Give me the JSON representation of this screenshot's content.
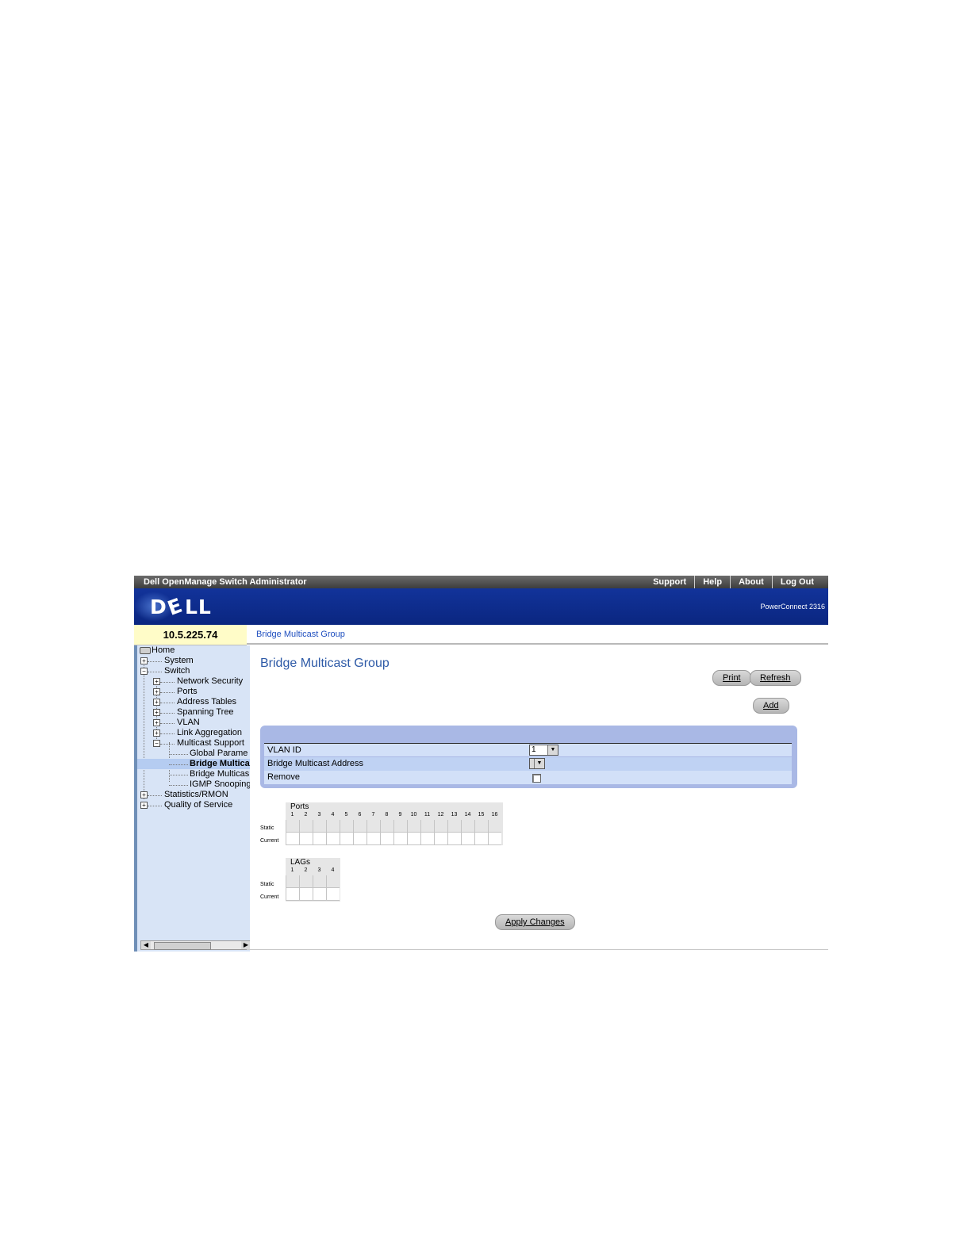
{
  "topbar": {
    "app_title": "Dell OpenManage Switch Administrator",
    "links": [
      "Support",
      "Help",
      "About",
      "Log Out"
    ]
  },
  "banner": {
    "logo_text": "DELL",
    "product": "PowerConnect 2316"
  },
  "address": "10.5.225.74",
  "breadcrumb": "Bridge Multicast Group",
  "sidebar": {
    "home": "Home",
    "system": "System",
    "switch": "Switch",
    "network_security": "Network Security",
    "ports": "Ports",
    "address_tables": "Address Tables",
    "spanning_tree": "Spanning Tree",
    "vlan": "VLAN",
    "link_aggregation": "Link Aggregation",
    "multicast_support": "Multicast Support",
    "global_params": "Global Parame",
    "bridge_multicast_group": "Bridge Multica",
    "bridge_multicast_forward": "Bridge Multicas",
    "igmp_snooping": "IGMP Snooping",
    "statistics_rmon": "Statistics/RMON",
    "qos": "Quality of Service"
  },
  "main": {
    "title": "Bridge Multicast Group",
    "print_label": "Print",
    "refresh_label": "Refresh",
    "add_label": "Add",
    "vlan_id_label": "VLAN ID",
    "vlan_id_value": "1",
    "bma_label": "Bridge Multicast Address",
    "remove_label": "Remove",
    "apply_label": "Apply Changes"
  },
  "ports_grid": {
    "title": "Ports",
    "numbers": [
      "1",
      "2",
      "3",
      "4",
      "5",
      "6",
      "7",
      "8",
      "9",
      "10",
      "11",
      "12",
      "13",
      "14",
      "15",
      "16"
    ],
    "row_static": "Static",
    "row_current": "Current"
  },
  "lags_grid": {
    "title": "LAGs",
    "numbers": [
      "1",
      "2",
      "3",
      "4"
    ],
    "row_static": "Static",
    "row_current": "Current"
  }
}
